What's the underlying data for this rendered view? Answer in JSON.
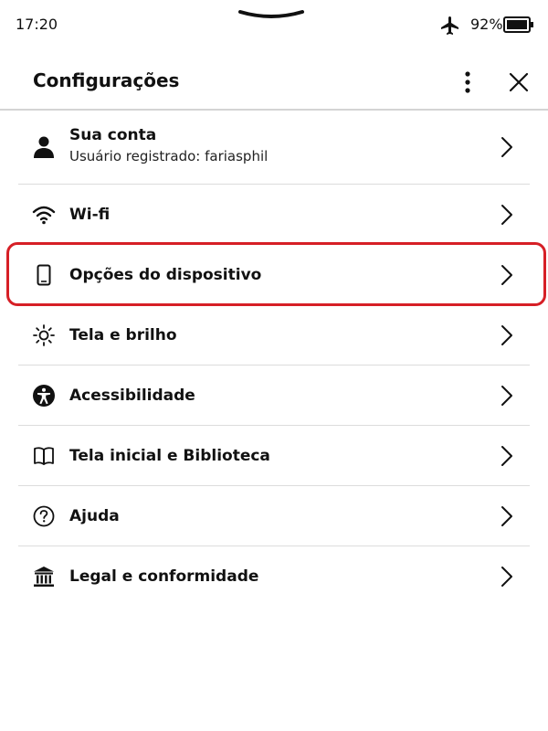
{
  "status_bar": {
    "time": "17:20",
    "airplane_icon": "airplane-icon",
    "battery_percent": "92%",
    "battery_icon": "battery-icon"
  },
  "header": {
    "title": "Configurações",
    "menu_icon": "more-vertical-icon",
    "close_icon": "close-icon"
  },
  "menu": {
    "items": [
      {
        "label": "Sua conta",
        "sublabel": "Usuário registrado: fariasphil",
        "icon": "person-icon"
      },
      {
        "label": "Wi-fi",
        "icon": "wifi-icon"
      },
      {
        "label": "Opções do dispositivo",
        "icon": "device-icon"
      },
      {
        "label": "Tela e brilho",
        "icon": "brightness-icon"
      },
      {
        "label": "Acessibilidade",
        "icon": "accessibility-icon"
      },
      {
        "label": "Tela inicial e Biblioteca",
        "icon": "book-icon"
      },
      {
        "label": "Ajuda",
        "icon": "help-icon"
      },
      {
        "label": "Legal e conformidade",
        "icon": "legal-building-icon"
      }
    ]
  },
  "highlight": {
    "target": "Opções do dispositivo",
    "color": "#d61f26"
  }
}
